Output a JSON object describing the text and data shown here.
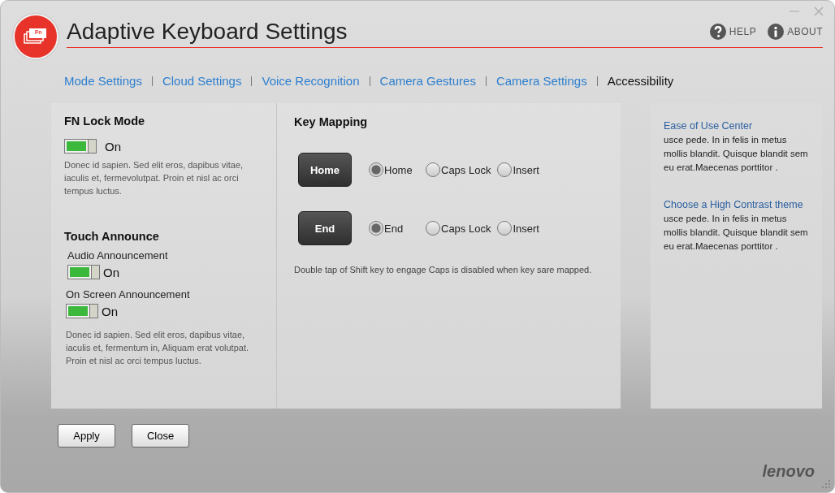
{
  "window": {
    "title": "Adaptive Keyboard Settings",
    "logo_text": "Fn",
    "header_links": [
      {
        "kind": "help",
        "label": "HELP"
      },
      {
        "kind": "about",
        "label": "ABOUT"
      }
    ]
  },
  "tabs": [
    {
      "label": "Mode Settings",
      "selected": false
    },
    {
      "label": "Cloud Settings",
      "selected": false
    },
    {
      "label": "Voice Recognition",
      "selected": false
    },
    {
      "label": "Camera Gestures",
      "selected": false
    },
    {
      "label": "Camera Settings",
      "selected": false
    },
    {
      "label": "Accessibility",
      "selected": true
    }
  ],
  "fn_lock": {
    "heading": "FN Lock Mode",
    "toggle": {
      "on": true,
      "label": "On"
    },
    "description": "Donec id sapien. Sed elit eros, dapibus vitae, iaculis et, fermevolutpat. Proin et nisl ac orci tempus luctus."
  },
  "touch_announce": {
    "heading": "Touch Announce",
    "items": [
      {
        "label": "Audio Announcement",
        "on": true,
        "state_label": "On"
      },
      {
        "label": "On Screen Announcement",
        "on": true,
        "state_label": "On"
      }
    ],
    "description": "Donec id sapien. Sed elit eros, dapibus vitae, iaculis et, fermentum in,  Aliquam erat volutpat. Proin et nisl ac orci tempus luctus."
  },
  "key_mapping": {
    "heading": "Key Mapping",
    "keys": [
      {
        "key": "Home",
        "options": [
          {
            "label": "Home",
            "selected": true
          },
          {
            "label": "Caps Lock",
            "selected": false
          },
          {
            "label": "Insert",
            "selected": false
          }
        ]
      },
      {
        "key": "End",
        "options": [
          {
            "label": "End",
            "selected": true
          },
          {
            "label": "Caps Lock",
            "selected": false
          },
          {
            "label": "Insert",
            "selected": false
          }
        ]
      }
    ],
    "note": "Double tap of Shift key to engage Caps is disabled when key sare mapped."
  },
  "side_panel": {
    "items": [
      {
        "link": "Ease of Use Center",
        "text": "usce pede. In in felis in metus mollis blandit. Quisque blandit sem eu erat.Maecenas porttitor ."
      },
      {
        "link": "Choose a High Contrast theme",
        "text": "usce pede. In in felis in metus mollis blandit. Quisque blandit sem eu erat.Maecenas porttitor ."
      }
    ]
  },
  "buttons": [
    "Apply",
    "Close"
  ],
  "brand": "lenovo"
}
